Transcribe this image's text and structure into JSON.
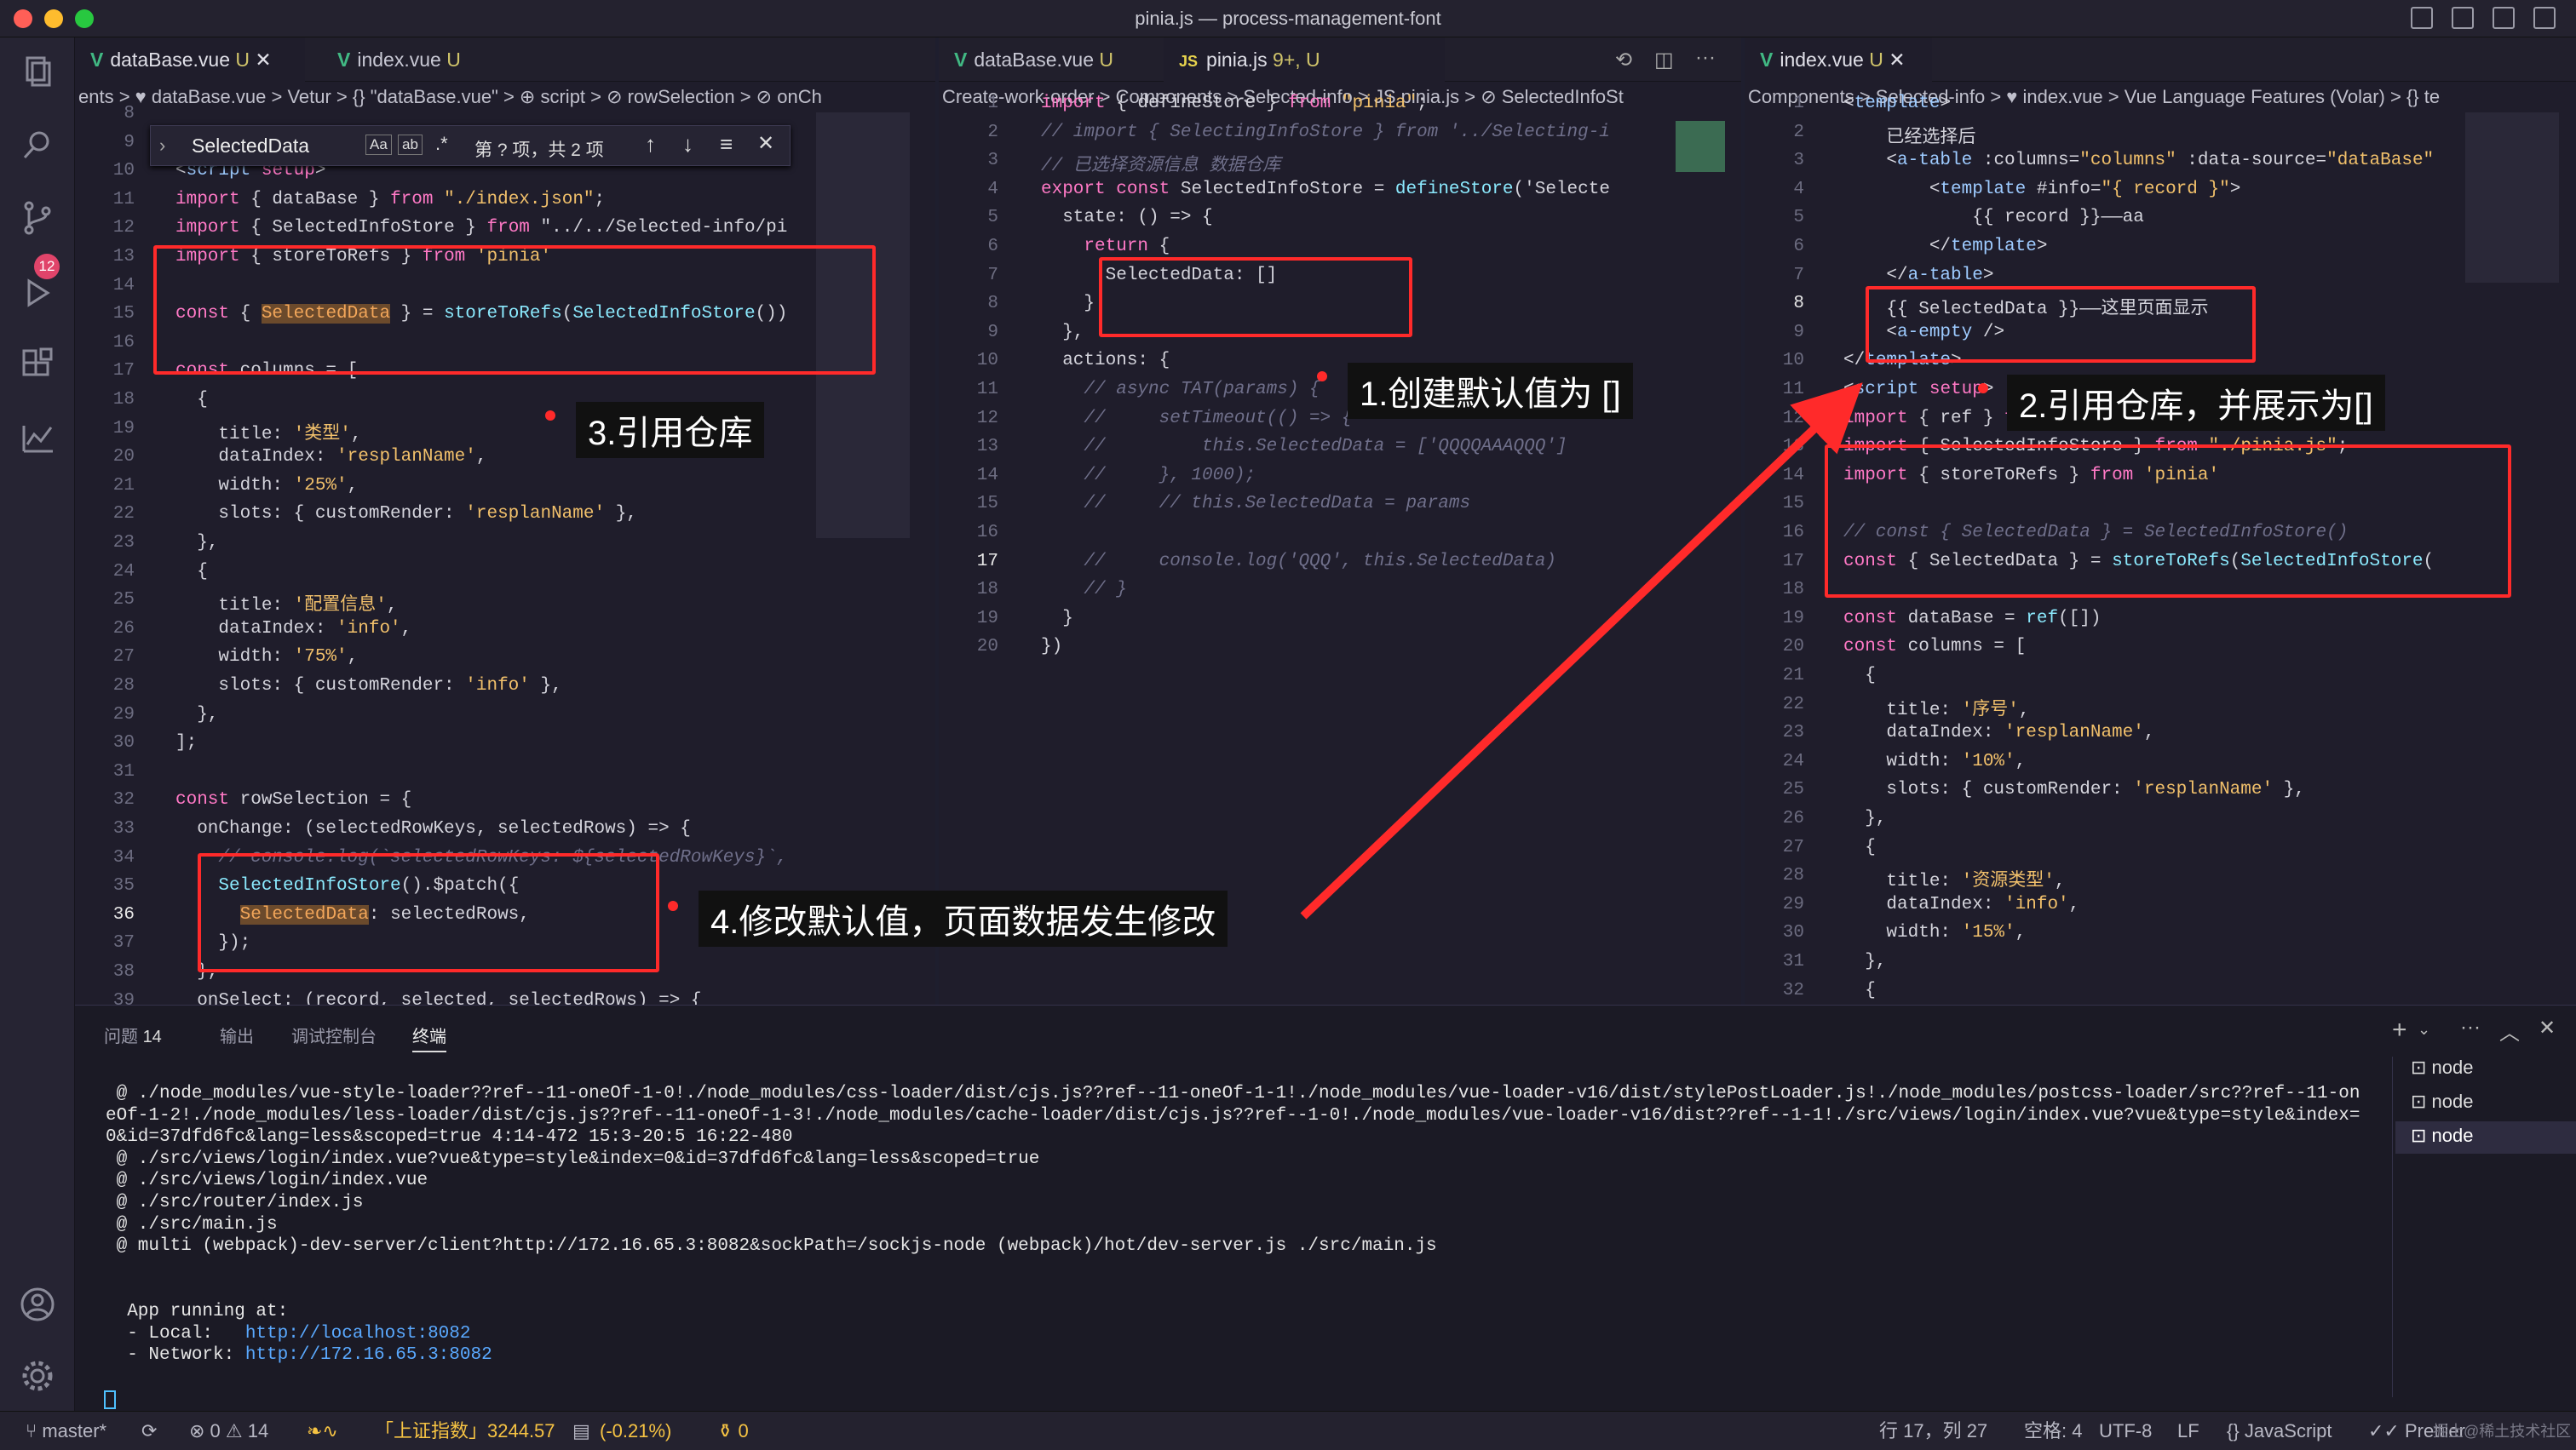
{
  "window": {
    "title": "pinia.js — process-management-font"
  },
  "activity": {
    "badge": "12",
    "items": [
      "explorer-icon",
      "search-icon",
      "source-control-icon",
      "run-debug-icon",
      "extensions-icon",
      "charts-icon",
      "account-icon",
      "settings-icon"
    ]
  },
  "pane1": {
    "tabs": [
      {
        "label": "dataBase.vue",
        "mark": "U"
      },
      {
        "label": "index.vue",
        "mark": "U"
      }
    ],
    "breadcrumb": "ents > ♥ dataBase.vue > Vetur > {} \"dataBase.vue\" > ⊕ script > ⊘ rowSelection > ⊘ onCh",
    "find": {
      "value": "SelectedData",
      "aa": "Aa",
      "ab": "ab",
      "regex": ".*",
      "result": "第 ? 项，共 2 项"
    },
    "lines": [
      {
        "n": "8",
        "t": ""
      },
      {
        "n": "9",
        "t": ""
      },
      {
        "n": "10",
        "t": "<script setup>"
      },
      {
        "n": "11",
        "t": "import { dataBase } from \"./index.json\";"
      },
      {
        "n": "12",
        "t": "import { SelectedInfoStore } from \"../../Selected-info/pi"
      },
      {
        "n": "13",
        "t": "import { storeToRefs } from 'pinia'"
      },
      {
        "n": "14",
        "t": ""
      },
      {
        "n": "15",
        "t": "const { SelectedData } = storeToRefs(SelectedInfoStore())"
      },
      {
        "n": "16",
        "t": ""
      },
      {
        "n": "17",
        "t": "const columns = ["
      },
      {
        "n": "18",
        "t": "  {"
      },
      {
        "n": "19",
        "t": "    title: '类型',"
      },
      {
        "n": "20",
        "t": "    dataIndex: 'resplanName',"
      },
      {
        "n": "21",
        "t": "    width: '25%',"
      },
      {
        "n": "22",
        "t": "    slots: { customRender: 'resplanName' },"
      },
      {
        "n": "23",
        "t": "  },"
      },
      {
        "n": "24",
        "t": "  {"
      },
      {
        "n": "25",
        "t": "    title: '配置信息',"
      },
      {
        "n": "26",
        "t": "    dataIndex: 'info',"
      },
      {
        "n": "27",
        "t": "    width: '75%',"
      },
      {
        "n": "28",
        "t": "    slots: { customRender: 'info' },"
      },
      {
        "n": "29",
        "t": "  },"
      },
      {
        "n": "30",
        "t": "];"
      },
      {
        "n": "31",
        "t": ""
      },
      {
        "n": "32",
        "t": "const rowSelection = {"
      },
      {
        "n": "33",
        "t": "  onChange: (selectedRowKeys, selectedRows) => {"
      },
      {
        "n": "34",
        "t": "    // console.log(`selectedRowKeys: ${selectedRowKeys}`,"
      },
      {
        "n": "35",
        "t": "    SelectedInfoStore().$patch({"
      },
      {
        "n": "36",
        "t": "      SelectedData: selectedRows,"
      },
      {
        "n": "37",
        "t": "    });"
      },
      {
        "n": "38",
        "t": "  },"
      },
      {
        "n": "39",
        "t": "  onSelect: (record, selected, selectedRows) => {"
      }
    ]
  },
  "pane2": {
    "tabs": [
      {
        "label": "dataBase.vue",
        "mark": "U"
      },
      {
        "label": "pinia.js",
        "mark": "9+, U"
      }
    ],
    "breadcrumb": "Create-work-order > Components > Selected-info > JS pinia.js > ⊘ SelectedInfoSt",
    "lines": [
      {
        "n": "1",
        "t": "import { defineStore } from \"pinia\";"
      },
      {
        "n": "2",
        "t": "// import { SelectingInfoStore } from '../Selecting-i"
      },
      {
        "n": "3",
        "t": "// 已选择资源信息 数据仓库"
      },
      {
        "n": "4",
        "t": "export const SelectedInfoStore = defineStore('Selecte"
      },
      {
        "n": "5",
        "t": "  state: () => {"
      },
      {
        "n": "6",
        "t": "    return {"
      },
      {
        "n": "7",
        "t": "      SelectedData: []"
      },
      {
        "n": "8",
        "t": "    }"
      },
      {
        "n": "9",
        "t": "  },"
      },
      {
        "n": "10",
        "t": "  actions: {"
      },
      {
        "n": "11",
        "t": "    // async TAT(params) {"
      },
      {
        "n": "12",
        "t": "    //     setTimeout(() => {"
      },
      {
        "n": "13",
        "t": "    //         this.SelectedData = ['QQQQAAAQQQ']"
      },
      {
        "n": "14",
        "t": "    //     }, 1000);"
      },
      {
        "n": "15",
        "t": "    //     // this.SelectedData = params"
      },
      {
        "n": "16",
        "t": ""
      },
      {
        "n": "17",
        "t": "    //     console.log('QQQ', this.SelectedData)"
      },
      {
        "n": "18",
        "t": "    // }"
      },
      {
        "n": "19",
        "t": "  }"
      },
      {
        "n": "20",
        "t": "})"
      }
    ]
  },
  "pane3": {
    "tabs": [
      {
        "label": "index.vue",
        "mark": "U"
      }
    ],
    "breadcrumb": "Components > Selected-info > ♥ index.vue > Vue Language Features (Volar) > {} te",
    "lines": [
      {
        "n": "1",
        "t": "<template>"
      },
      {
        "n": "2",
        "t": "    已经选择后"
      },
      {
        "n": "3",
        "t": "    <a-table :columns=\"columns\" :data-source=\"dataBase\""
      },
      {
        "n": "4",
        "t": "        <template #info=\"{ record }\">"
      },
      {
        "n": "5",
        "t": "            {{ record }}——aa"
      },
      {
        "n": "6",
        "t": "        </template>"
      },
      {
        "n": "7",
        "t": "    </a-table>"
      },
      {
        "n": "8",
        "t": "    {{ SelectedData }}——这里页面显示"
      },
      {
        "n": "9",
        "t": "    <a-empty />"
      },
      {
        "n": "10",
        "t": "</template>"
      },
      {
        "n": "11",
        "t": "<script setup>"
      },
      {
        "n": "12",
        "t": "import { ref } from \"vue\";"
      },
      {
        "n": "13",
        "t": "import { SelectedInfoStore } from \"./pinia.js\";"
      },
      {
        "n": "14",
        "t": "import { storeToRefs } from 'pinia'"
      },
      {
        "n": "15",
        "t": ""
      },
      {
        "n": "16",
        "t": "// const { SelectedData } = SelectedInfoStore()"
      },
      {
        "n": "17",
        "t": "const { SelectedData } = storeToRefs(SelectedInfoStore("
      },
      {
        "n": "18",
        "t": ""
      },
      {
        "n": "19",
        "t": "const dataBase = ref([])"
      },
      {
        "n": "20",
        "t": "const columns = ["
      },
      {
        "n": "21",
        "t": "  {"
      },
      {
        "n": "22",
        "t": "    title: '序号',"
      },
      {
        "n": "23",
        "t": "    dataIndex: 'resplanName',"
      },
      {
        "n": "24",
        "t": "    width: '10%',"
      },
      {
        "n": "25",
        "t": "    slots: { customRender: 'resplanName' },"
      },
      {
        "n": "26",
        "t": "  },"
      },
      {
        "n": "27",
        "t": "  {"
      },
      {
        "n": "28",
        "t": "    title: '资源类型',"
      },
      {
        "n": "29",
        "t": "    dataIndex: 'info',"
      },
      {
        "n": "30",
        "t": "    width: '15%',"
      },
      {
        "n": "31",
        "t": "  },"
      },
      {
        "n": "32",
        "t": "  {"
      }
    ]
  },
  "annotations": {
    "a1": "1.创建默认值为 []",
    "a2": "2.引用仓库，并展示为[]",
    "a3": "3.引用仓库",
    "a4": "4.修改默认值，页面数据发生修改"
  },
  "panel": {
    "tabs": [
      {
        "label": "问题",
        "count": "14"
      },
      {
        "label": "输出"
      },
      {
        "label": "调试控制台"
      },
      {
        "label": "终端"
      }
    ],
    "terminal": [
      " @ ./node_modules/vue-style-loader??ref--11-oneOf-1-0!./node_modules/css-loader/dist/cjs.js??ref--11-oneOf-1-1!./node_modules/vue-loader-v16/dist/stylePostLoader.js!./node_modules/postcss-loader/src??ref--11-on",
      "eOf-1-2!./node_modules/less-loader/dist/cjs.js??ref--11-oneOf-1-3!./node_modules/cache-loader/dist/cjs.js??ref--1-0!./node_modules/vue-loader-v16/dist??ref--1-1!./src/views/login/index.vue?vue&type=style&index=",
      "0&id=37dfd6fc&lang=less&scoped=true 4:14-472 15:3-20:5 16:22-480",
      " @ ./src/views/login/index.vue?vue&type=style&index=0&id=37dfd6fc&lang=less&scoped=true",
      " @ ./src/views/login/index.vue",
      " @ ./src/router/index.js",
      " @ ./src/main.js",
      " @ multi (webpack)-dev-server/client?http://172.16.65.3:8082&sockPath=/sockjs-node (webpack)/hot/dev-server.js ./src/main.js",
      "",
      "",
      "  App running at:",
      "  - Local:   ",
      "  - Network: "
    ],
    "local_url": "http://localhost:8082",
    "network_url": "http://172.16.65.3:8082",
    "terminals": [
      "node",
      "node",
      "node"
    ]
  },
  "status": {
    "branch": "master*",
    "errors": "0",
    "warnings": "14",
    "stock": "「上证指数」3244.57",
    "change": "(-0.21%)",
    "ports": "0",
    "position": "行 17，列 27",
    "spaces": "空格: 4",
    "encoding": "UTF-8",
    "eol": "LF",
    "language": "JavaScript",
    "formatter": "Prettier",
    "watermark": "掘土@稀土技术社区"
  },
  "colors": {
    "annotation": "#ff2a2a",
    "accent": "#41b883"
  }
}
